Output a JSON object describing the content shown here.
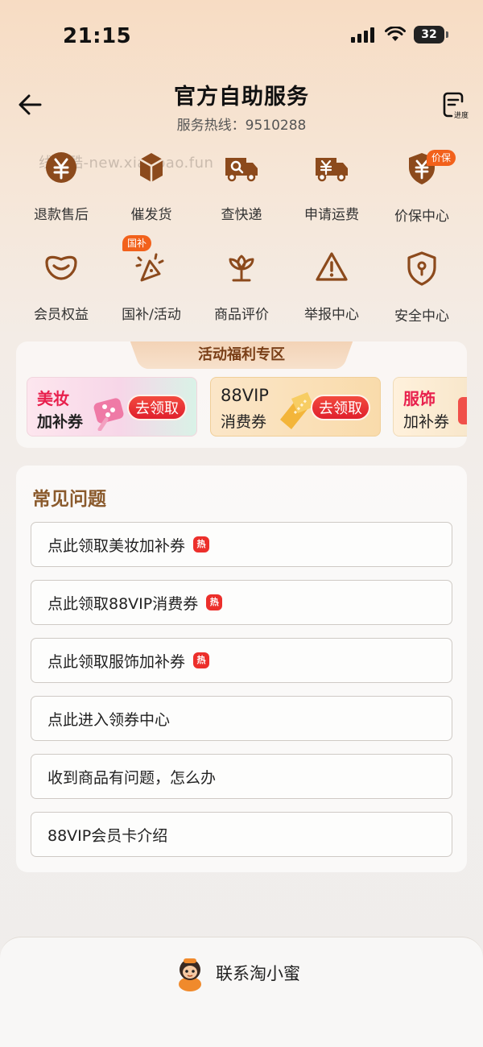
{
  "status_bar": {
    "time": "21:15",
    "battery": "32"
  },
  "header": {
    "title": "官方自助服务",
    "hotline": "服务热线：9510288",
    "progress_label": "进度"
  },
  "watermark": "线报酷-new.xianbao.fun",
  "services": [
    {
      "label": "退款售后",
      "icon": "refund-icon"
    },
    {
      "label": "催发货",
      "icon": "urge-shipping-icon"
    },
    {
      "label": "查快递",
      "icon": "track-delivery-icon"
    },
    {
      "label": "申请运费",
      "icon": "shipping-fee-icon"
    },
    {
      "label": "价保中心",
      "icon": "price-protect-icon",
      "badge": "价保"
    },
    {
      "label": "会员权益",
      "icon": "member-icon"
    },
    {
      "label": "国补/活动",
      "icon": "subsidy-icon",
      "badge": "国补"
    },
    {
      "label": "商品评价",
      "icon": "review-icon"
    },
    {
      "label": "举报中心",
      "icon": "report-icon"
    },
    {
      "label": "安全中心",
      "icon": "security-icon"
    }
  ],
  "promo": {
    "title": "活动福利专区",
    "coupons": [
      {
        "line1": "美妆",
        "line2": "加补券",
        "button": "去领取"
      },
      {
        "line1": "88VIP",
        "line2": "消费券",
        "button": "去领取"
      },
      {
        "line1": "服饰",
        "line2": "加补券"
      }
    ]
  },
  "faq": {
    "title": "常见问题",
    "hot_label": "热",
    "items": [
      {
        "text": "点此领取美妆加补券",
        "hot": true
      },
      {
        "text": "点此领取88VIP消费券",
        "hot": true
      },
      {
        "text": "点此领取服饰加补券",
        "hot": true
      },
      {
        "text": "点此进入领券中心",
        "hot": false
      },
      {
        "text": "收到商品有问题，怎么办",
        "hot": false
      },
      {
        "text": "88VIP会员卡介绍",
        "hot": false
      }
    ]
  },
  "bottom": {
    "contact_label": "联系淘小蜜"
  },
  "colors": {
    "accent": "#8a5a2c",
    "icon_brown": "#8c4a1c",
    "hot_red": "#ec2f2b",
    "badge_orange": "#f2611b"
  }
}
